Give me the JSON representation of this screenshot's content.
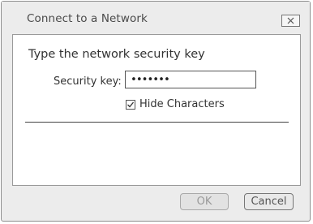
{
  "window": {
    "title": "Connect to a Network",
    "close_icon": "close-icon"
  },
  "main": {
    "heading": "Type the network security key",
    "security_key_label": "Security key:",
    "security_key_value": "•••••••",
    "hide_characters": {
      "label": "Hide Characters",
      "checked": true
    }
  },
  "footer": {
    "ok_label": "OK",
    "ok_enabled": false,
    "cancel_label": "Cancel"
  }
}
